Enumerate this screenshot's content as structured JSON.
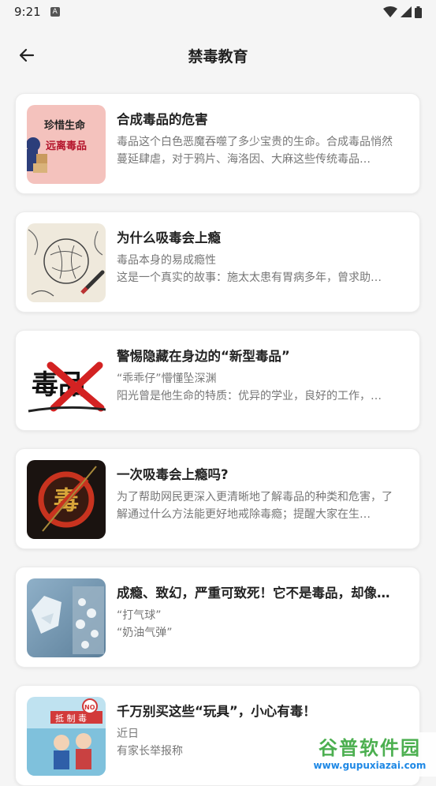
{
  "status_bar": {
    "time": "9:21",
    "notif_glyph": "A"
  },
  "header": {
    "title": "禁毒教育",
    "back_icon": "arrow-left-icon"
  },
  "articles": [
    {
      "title": "合成毒品的危害",
      "desc": "毒品这个白色恶魔吞噬了多少宝贵的生命。合成毒品悄然蔓延肆虐，对于鸦片、海洛因、大麻这些传统毒品…",
      "thumb": {
        "line1": "珍惜生命",
        "line2": "远离毒品"
      }
    },
    {
      "title": "为什么吸毒会上瘾",
      "line1": "毒品本身的易成瘾性",
      "line2": "这是一个真实的故事：施太太患有胃病多年，曾求助…"
    },
    {
      "title": "警惕隐藏在身边的“新型毒品”",
      "line1": "“乖乖仔”懵懂坠深渊",
      "line2": "阳光曾是他生命的特质：优异的学业，良好的工作，…",
      "thumb": {
        "text": "毒品"
      }
    },
    {
      "title": "一次吸毒会上瘾吗?",
      "desc": "为了帮助网民更深入更清晰地了解毒品的种类和危害，了解通过什么方法能更好地戒除毒瘾；提醒大家在生…",
      "thumb": {
        "text": "毒"
      }
    },
    {
      "title": "成瘾、致幻，严重可致死！它不是毒品，却像…",
      "line1": "“打气球”",
      "line2": "“奶油气弹”"
    },
    {
      "title": "千万别买这些“玩具”，小心有毒！",
      "line1": "近日",
      "line2": "有家长举报称",
      "thumb": {
        "sign": "抵 制 毒",
        "badge": "NO"
      }
    }
  ],
  "watermark": {
    "title": "谷普软件园",
    "url": "www.gupuxiazai.com"
  }
}
